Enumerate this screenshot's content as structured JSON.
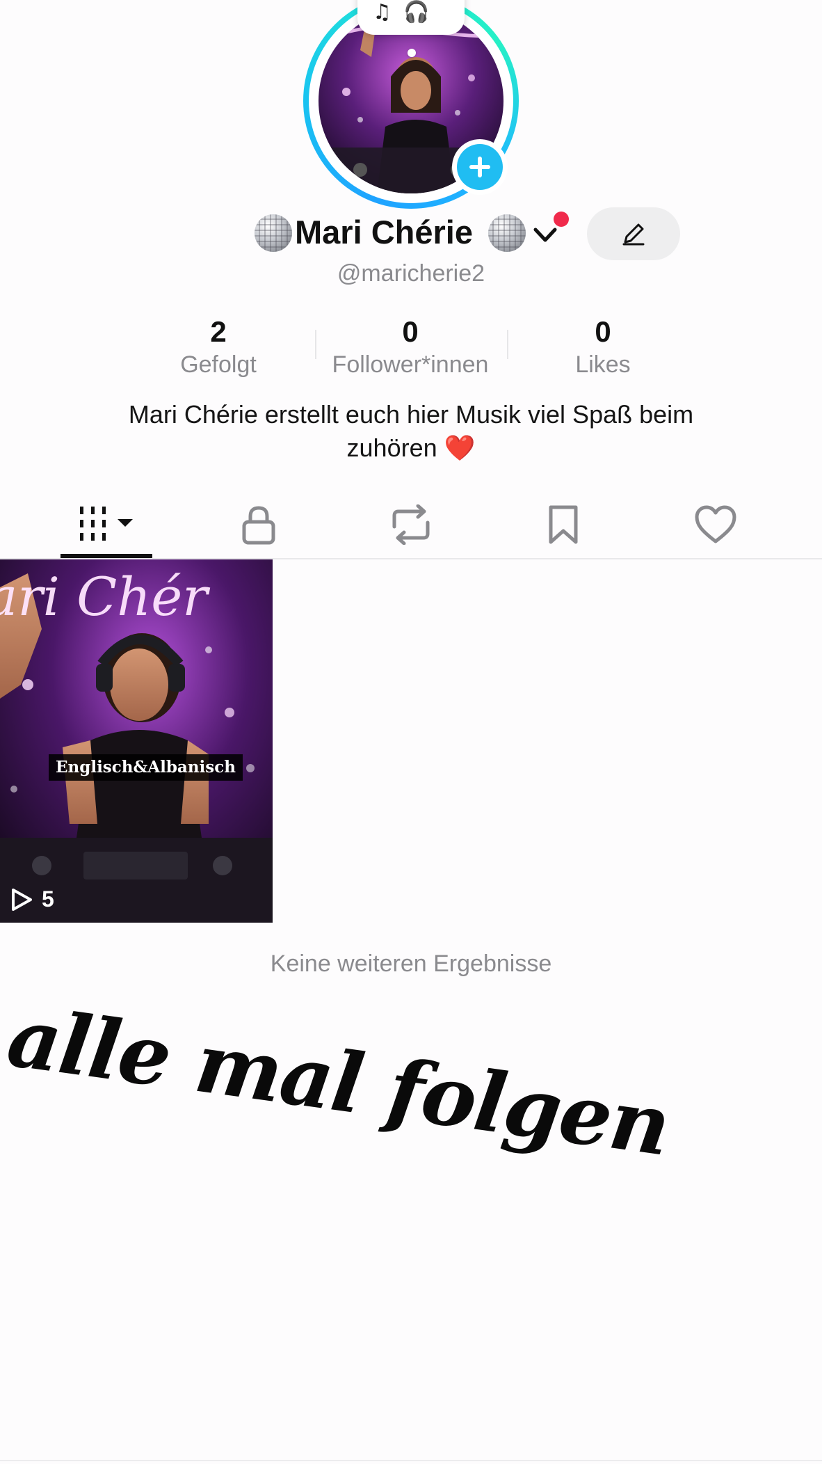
{
  "profile": {
    "name": "Mari Chérie",
    "username": "@maricherie2",
    "bio_line1": "Mari Chérie erstellt euch hier Musik viel Spaß beim",
    "bio_line2": "zuhören ❤️",
    "note_glyphs": "♫ 🎧"
  },
  "stats": [
    {
      "value": "2",
      "label": "Gefolgt"
    },
    {
      "value": "0",
      "label": "Follower*innen"
    },
    {
      "value": "0",
      "label": "Likes"
    }
  ],
  "tabs": [
    {
      "id": "videos",
      "icon": "grid-bars-icon",
      "active": true
    },
    {
      "id": "private",
      "icon": "lock-icon",
      "active": false
    },
    {
      "id": "reposts",
      "icon": "repost-icon",
      "active": false
    },
    {
      "id": "saved",
      "icon": "bookmark-icon",
      "active": false
    },
    {
      "id": "liked",
      "icon": "heart-outline-icon",
      "active": false
    }
  ],
  "videos": [
    {
      "caption": "Englisch&Albanisch",
      "views": "5",
      "neon_text": "ari Chér"
    }
  ],
  "footer": {
    "no_more_results": "Keine weiteren Ergebnisse"
  },
  "sticker_text": "alle mal folgen",
  "colors": {
    "accent_blue": "#20bdf2",
    "ring_cyan": "#20e3d8",
    "notification_red": "#f02a4b",
    "text_primary": "#111111",
    "text_secondary": "#8a8a8e"
  }
}
